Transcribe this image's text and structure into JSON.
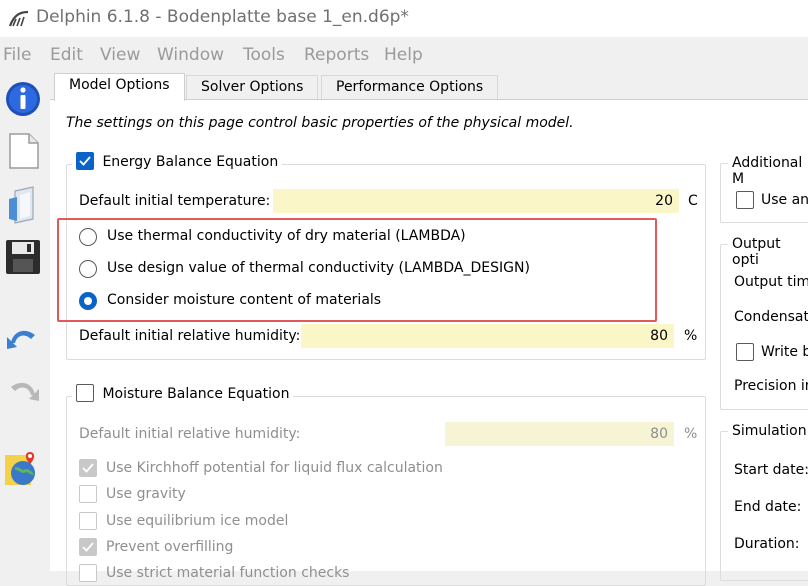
{
  "window": {
    "title": "Delphin 6.1.8 - Bodenplatte base 1_en.d6p*"
  },
  "menu": [
    "File",
    "Edit",
    "View",
    "Window",
    "Tools",
    "Reports",
    "Help"
  ],
  "toolbar": [
    "info-icon",
    "new-file-icon",
    "open-file-icon",
    "save-icon",
    "undo-icon",
    "redo-icon",
    "globe-location-icon"
  ],
  "tabs": [
    "Model Options",
    "Solver Options",
    "Performance Options"
  ],
  "intro": "The settings on this page control basic properties of the physical model.",
  "energy": {
    "title": "Energy Balance Equation",
    "checked": true,
    "temp_label": "Default initial temperature:",
    "temp_value": "20",
    "temp_unit": "C",
    "radio_dry": "Use thermal conductivity of dry material (LAMBDA)",
    "radio_design": "Use design value of thermal conductivity (LAMBDA_DESIGN)",
    "radio_moisture": "Consider moisture content of materials",
    "rh_label": "Default initial relative humidity:",
    "rh_value": "80",
    "rh_unit": "%"
  },
  "moisture": {
    "title": "Moisture Balance Equation",
    "checked": false,
    "rh_label": "Default initial relative humidity:",
    "rh_value": "80",
    "rh_unit": "%",
    "opt_kirchhoff": "Use Kirchhoff potential for liquid flux calculation",
    "opt_gravity": "Use gravity",
    "opt_ice": "Use equilibrium ice model",
    "opt_overfill": "Prevent overfilling",
    "opt_strict": "Use strict material function checks"
  },
  "additional": {
    "title": "Additional M",
    "opt_use": "Use an"
  },
  "output": {
    "title": "Output opti",
    "time": "Output time",
    "condensate": "Condensate",
    "write": "Write b",
    "precision": "Precision in"
  },
  "simulation": {
    "title": "Simulation",
    "start": "Start date:",
    "end": "End date:",
    "duration": "Duration:"
  },
  "colors": {
    "accent": "#0a64c8",
    "field_bg": "#fbf6c8",
    "highlight": "#e05a5a"
  }
}
